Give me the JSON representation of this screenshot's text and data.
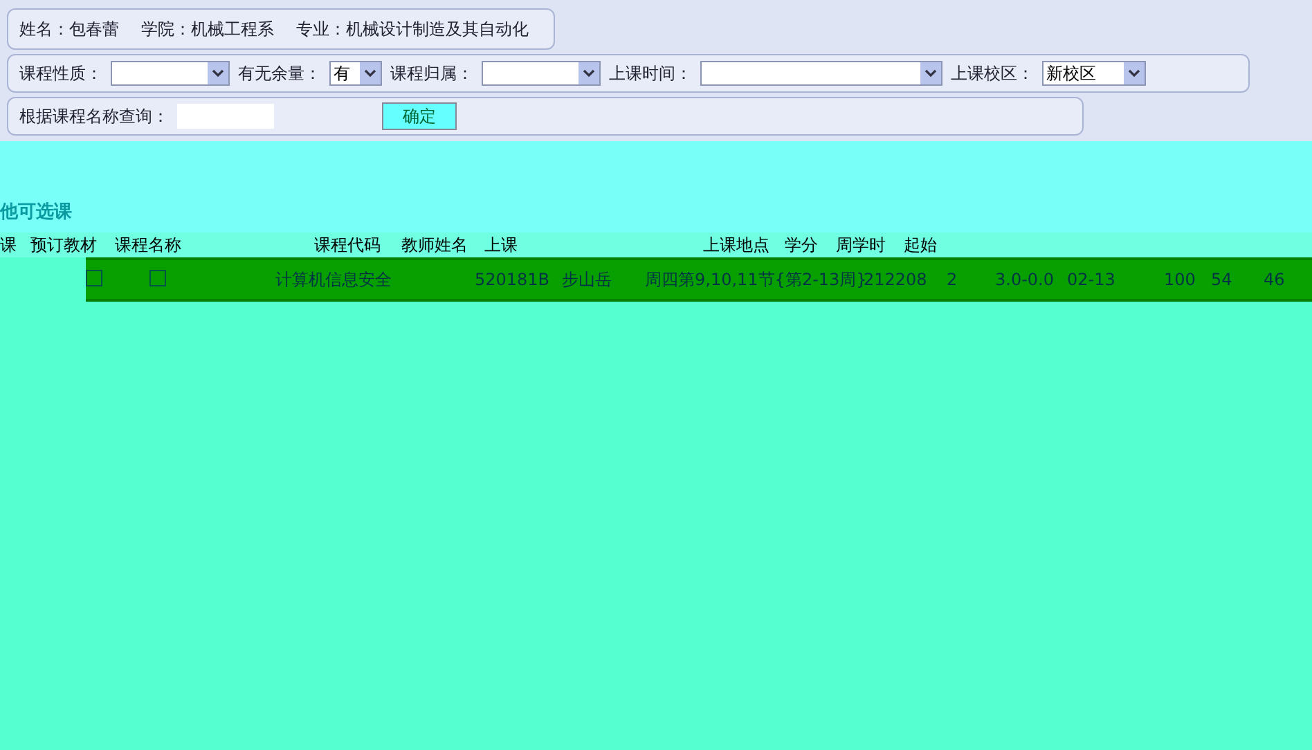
{
  "student_info": [
    {
      "label": "姓名：",
      "value": "包春蕾"
    },
    {
      "label": "学院：",
      "value": "机械工程系"
    },
    {
      "label": "专业：",
      "value": "机械设计制造及其自动化"
    }
  ],
  "filters": [
    {
      "label": "课程性质："
    },
    {
      "label": "有无余量：",
      "value": "有"
    },
    {
      "label": "课程归属："
    },
    {
      "label": "上课时间："
    },
    {
      "label": "上课校区：",
      "value": "新校区"
    }
  ],
  "search": {
    "label": "根据课程名称查询：",
    "button": "确定"
  },
  "section_title": "他可选课",
  "table": {
    "columns": [
      "课",
      "预订教材",
      "课程名称",
      "课程代码",
      "教师姓名",
      "上课",
      "上课地点",
      "学分",
      "周学时",
      "起始"
    ],
    "rows": [
      {
        "selected": false,
        "book_textbook": false,
        "course_name": "计算机信息安全",
        "course_code": "520181B",
        "teacher": "步山岳",
        "time": "周四第9,10,11节{第2-13周}",
        "place": "212208",
        "credit": "2",
        "weekly_hours": "3.0-0.0",
        "period": "02-13",
        "column_11": "100",
        "column_12": "54",
        "column_13": "46"
      }
    ]
  }
}
